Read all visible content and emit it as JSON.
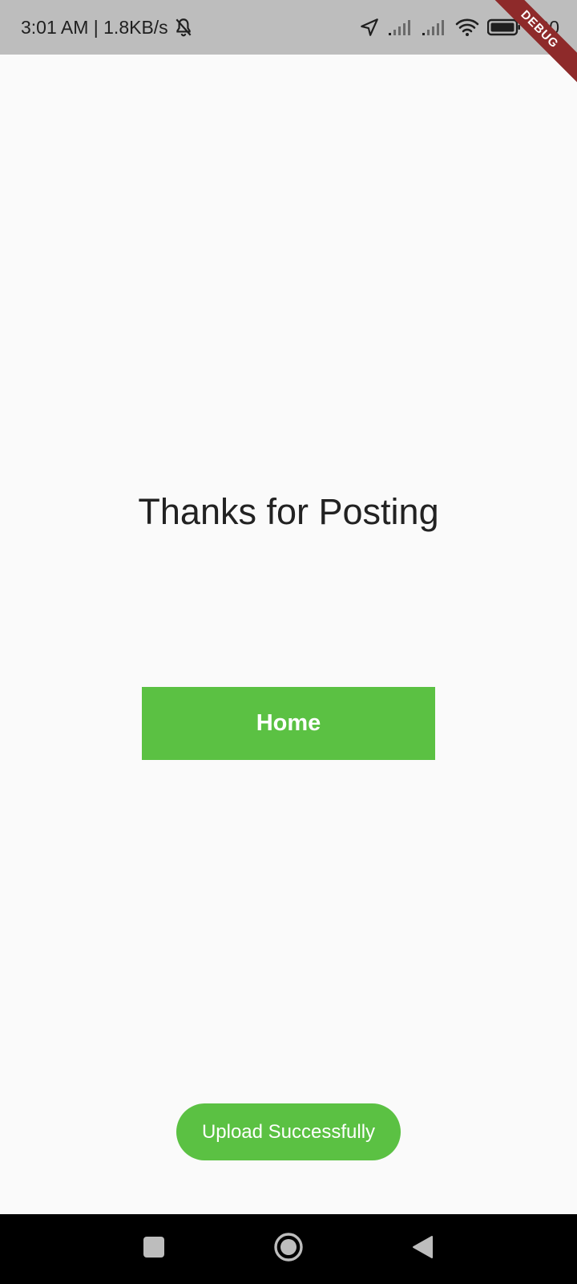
{
  "status_bar": {
    "time_speed": "3:01 AM | 1.8KB/s",
    "battery": "100",
    "icons": [
      "bell-off-icon",
      "location-arrow-icon",
      "signal-icon",
      "signal-icon",
      "wifi-icon",
      "battery-icon"
    ]
  },
  "debug_banner": "DEBUG",
  "main": {
    "title": "Thanks for Posting",
    "home_button": "Home"
  },
  "toast": "Upload Successfully",
  "colors": {
    "accent": "#5bc143",
    "background": "#fafafa",
    "status_bar": "#bdbdbd",
    "debug": "#8e2a2a"
  },
  "nav_bar": {
    "icons": [
      "recent-apps-icon",
      "home-circle-icon",
      "back-triangle-icon"
    ]
  }
}
